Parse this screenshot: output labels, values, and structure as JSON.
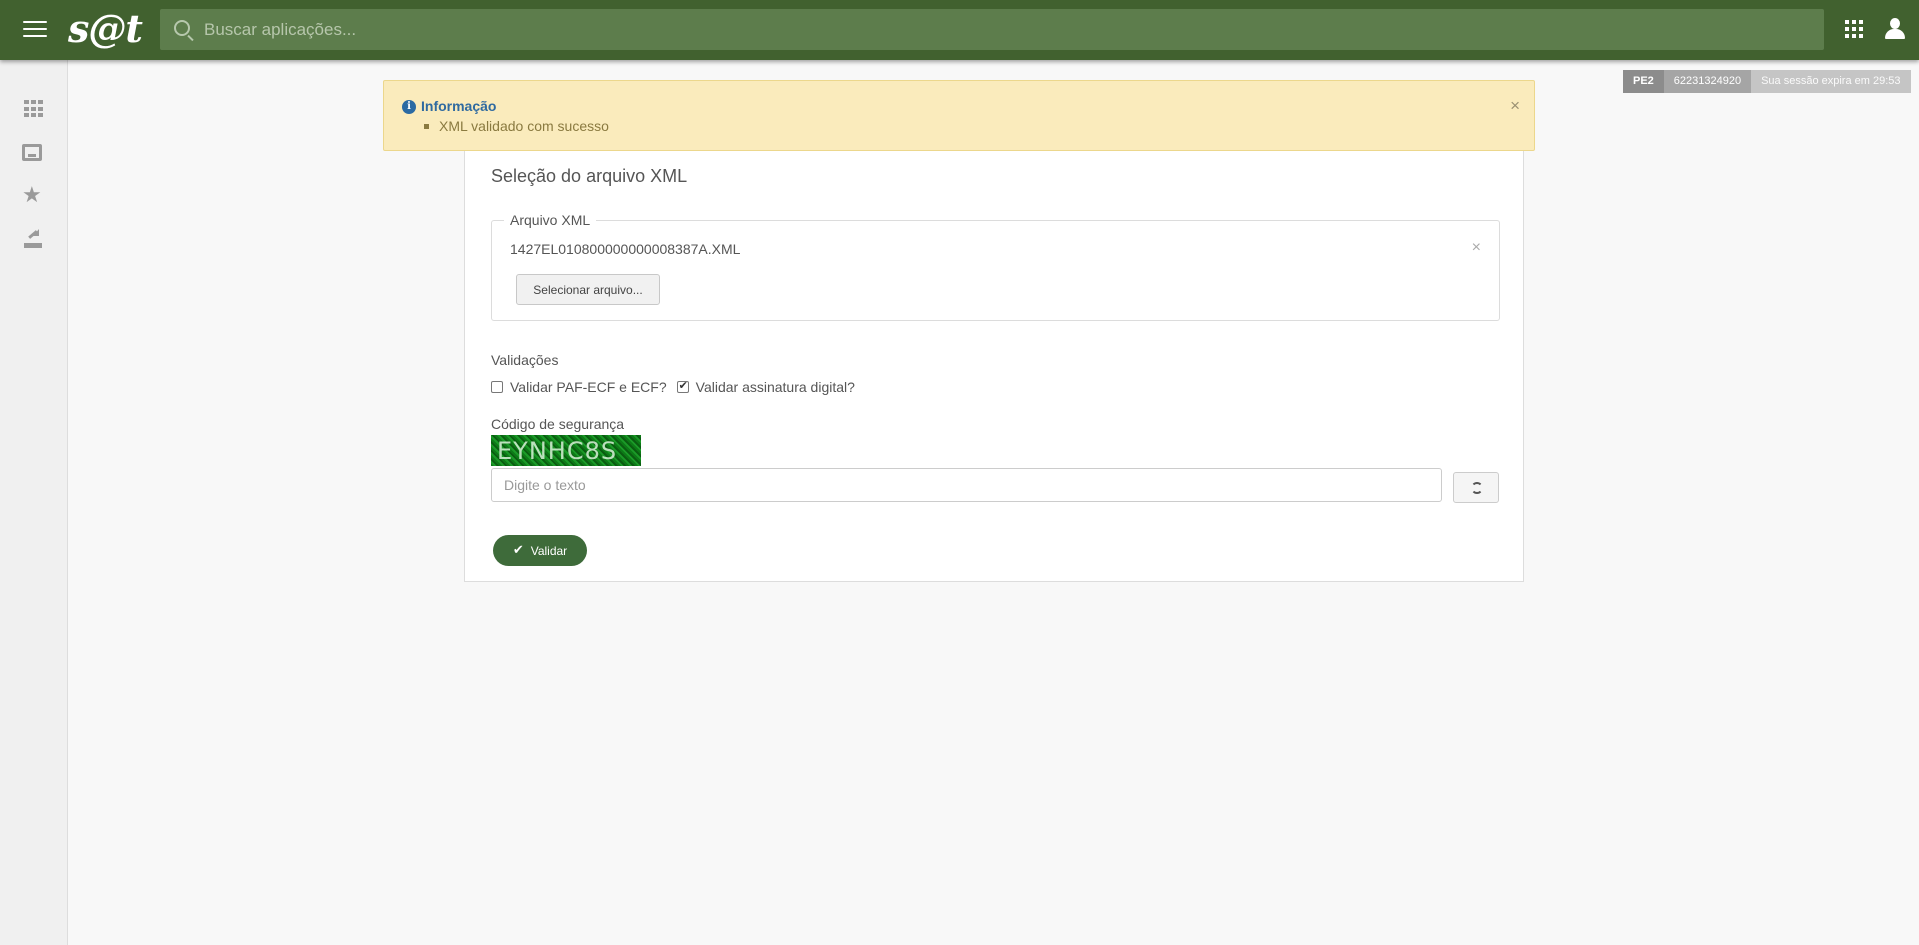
{
  "topbar": {
    "logo": "s@t",
    "search_placeholder": "Buscar aplicações..."
  },
  "sidebar": {
    "items": [
      {
        "icon": "grid-icon"
      },
      {
        "icon": "inbox-icon"
      },
      {
        "icon": "star-icon"
      },
      {
        "icon": "upload-icon"
      }
    ]
  },
  "session": {
    "state": "PE2",
    "user": "62231324920",
    "expires": "Sua sessão expira em 29:53"
  },
  "alert": {
    "title": "Informação",
    "message": "XML validado com sucesso",
    "close": "×"
  },
  "form": {
    "title": "Seleção do arquivo XML",
    "file_legend": "Arquivo XML",
    "filename": "1427EL010800000000008387A.XML",
    "remove": "×",
    "select_button": "Selecionar arquivo...",
    "validations_label": "Validações",
    "check_paf_label": "Validar PAF-ECF e ECF?",
    "check_paf_checked": false,
    "check_sig_label": "Validar assinatura digital?",
    "check_sig_checked": true,
    "security_label": "Código de segurança",
    "captcha_text": "EYNHC8S",
    "code_placeholder": "Digite o texto",
    "submit_label": "Validar"
  },
  "colors": {
    "topbar": "#41612f",
    "search": "#5d7d4c",
    "primary_button": "#3e6b3a",
    "alert_bg": "#faebbc"
  }
}
